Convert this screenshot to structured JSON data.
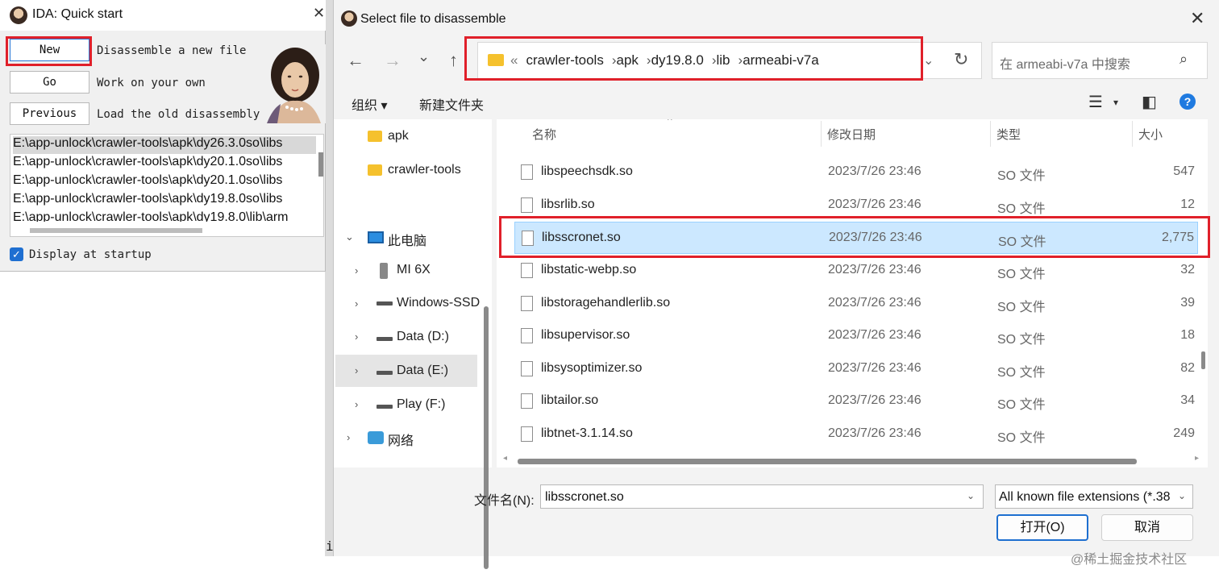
{
  "ida": {
    "title": "IDA: Quick start",
    "close_glyph": "✕",
    "buttons": [
      {
        "label": "New",
        "desc": "Disassemble a new file"
      },
      {
        "label": "Go",
        "desc": "Work on your own"
      },
      {
        "label": "Previous",
        "desc": "Load the old disassembly"
      }
    ],
    "recent": [
      "E:\\app-unlock\\crawler-tools\\apk\\dy26.3.0so\\libs",
      "E:\\app-unlock\\crawler-tools\\apk\\dy20.1.0so\\libs",
      "E:\\app-unlock\\crawler-tools\\apk\\dy20.1.0so\\libs",
      "E:\\app-unlock\\crawler-tools\\apk\\dy19.8.0so\\libs",
      "E:\\app-unlock\\crawler-tools\\apk\\dy19.8.0\\lib\\arm"
    ],
    "display_at_startup": "Display at startup",
    "display_checked": true
  },
  "dialog": {
    "title": "Select file to disassemble",
    "close_glyph": "✕",
    "nav": {
      "back": "←",
      "forward": "→",
      "recent": "⌄",
      "up": "↑"
    },
    "breadcrumb": [
      "crawler-tools",
      "apk",
      "dy19.8.0",
      "lib",
      "armeabi-v7a"
    ],
    "breadcrumb_prefix": "«",
    "breadcrumb_sep": "›",
    "search_placeholder": "在 armeabi-v7a 中搜索",
    "toolbar": {
      "organize": "组织 ▾",
      "new_folder": "新建文件夹"
    },
    "nav_pane": [
      {
        "label": "apk",
        "icon": "folder-icon"
      },
      {
        "label": "crawler-tools",
        "icon": "folder-icon"
      },
      {
        "label": "此电脑",
        "icon": "pc-icon"
      },
      {
        "label": "MI 6X",
        "icon": "phone-icon"
      },
      {
        "label": "Windows-SSD",
        "icon": "drive-icon"
      },
      {
        "label": "Data (D:)",
        "icon": "drive-icon"
      },
      {
        "label": "Data (E:)",
        "icon": "drive-icon"
      },
      {
        "label": "Play (F:)",
        "icon": "drive-icon"
      },
      {
        "label": "网络",
        "icon": "network-icon"
      }
    ],
    "columns": {
      "name": "名称",
      "date": "修改日期",
      "type": "类型",
      "size": "大小"
    },
    "files": [
      {
        "name": "libspeechsdk.so",
        "date": "2023/7/26 23:46",
        "type": "SO 文件",
        "size": "547"
      },
      {
        "name": "libsrlib.so",
        "date": "2023/7/26 23:46",
        "type": "SO 文件",
        "size": "12"
      },
      {
        "name": "libsscronet.so",
        "date": "2023/7/26 23:46",
        "type": "SO 文件",
        "size": "2,775"
      },
      {
        "name": "libstatic-webp.so",
        "date": "2023/7/26 23:46",
        "type": "SO 文件",
        "size": "32"
      },
      {
        "name": "libstoragehandlerlib.so",
        "date": "2023/7/26 23:46",
        "type": "SO 文件",
        "size": "39"
      },
      {
        "name": "libsupervisor.so",
        "date": "2023/7/26 23:46",
        "type": "SO 文件",
        "size": "18"
      },
      {
        "name": "libsysoptimizer.so",
        "date": "2023/7/26 23:46",
        "type": "SO 文件",
        "size": "82"
      },
      {
        "name": "libtailor.so",
        "date": "2023/7/26 23:46",
        "type": "SO 文件",
        "size": "34"
      },
      {
        "name": "libtnet-3.1.14.so",
        "date": "2023/7/26 23:46",
        "type": "SO 文件",
        "size": "249"
      }
    ],
    "selected_file_index": 2,
    "filename_label": "文件名(N):",
    "filename_value": "libsscronet.so",
    "filter_value": "All known file extensions (*.38",
    "open_button": "打开(O)",
    "cancel_button": "取消"
  },
  "watermark": "@稀土掘金技术社区",
  "colors": {
    "highlight_box": "#e0202a",
    "selection": "#cce8ff",
    "accent": "#1e6fd0"
  }
}
